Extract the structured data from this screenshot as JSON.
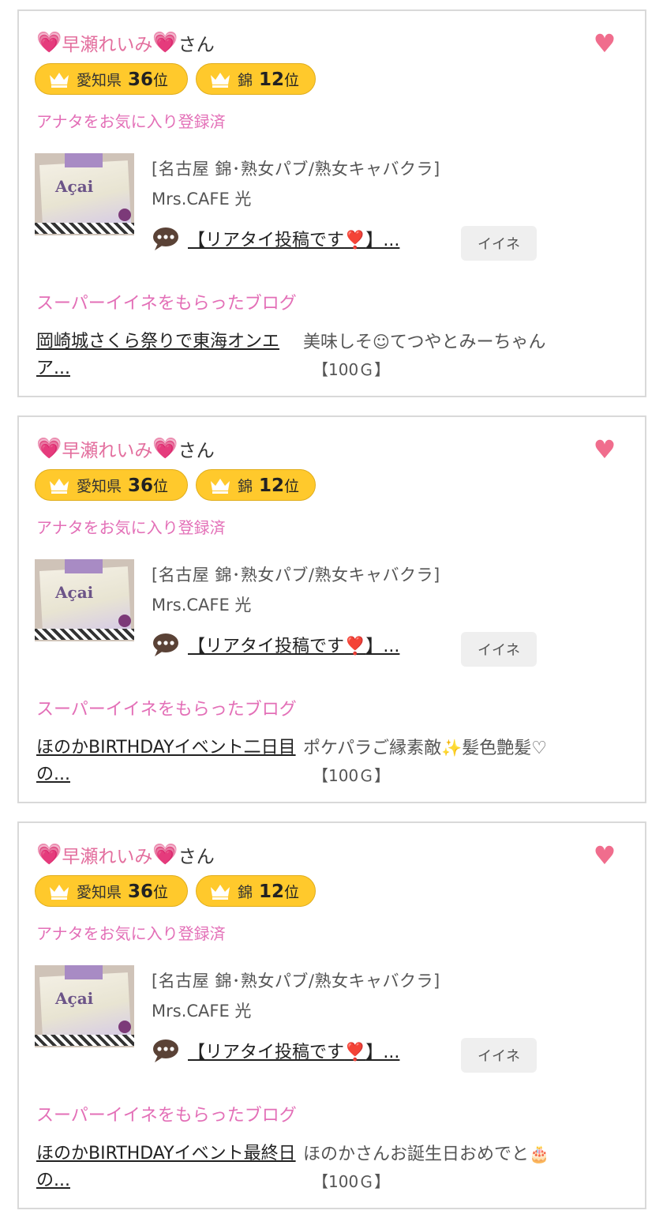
{
  "cards": [
    {
      "heart_left": "💗",
      "name": "早瀬れいみ",
      "heart_right": "💗",
      "honorific": "さん",
      "fav_heart": "♥",
      "badges": [
        {
          "area": "愛知県",
          "rank": "36",
          "suffix": "位"
        },
        {
          "area": "錦",
          "rank": "12",
          "suffix": "位"
        }
      ],
      "fav_status": "アナタをお気に入り登録済",
      "thumb_text": "Açai",
      "shop_category": "[名古屋 錦･熟女パブ/熟女キャバクラ]",
      "shop_name": "Mrs.CAFE 光",
      "post_title_pre": "【リアタイ投稿です",
      "post_title_mark": "❣️",
      "post_title_post": "】...",
      "like_label": "イイネ",
      "super_title": "スーパーイイネをもらったブログ",
      "blog_title": "岡崎城さくら祭りで東海オンエア...",
      "blog_desc_pre": "美味しそ",
      "blog_desc_emoji": "☺",
      "blog_desc_post": "てつやとみーちゃん",
      "blog_gold": "【100Ｇ】"
    },
    {
      "heart_left": "💗",
      "name": "早瀬れいみ",
      "heart_right": "💗",
      "honorific": "さん",
      "fav_heart": "♥",
      "badges": [
        {
          "area": "愛知県",
          "rank": "36",
          "suffix": "位"
        },
        {
          "area": "錦",
          "rank": "12",
          "suffix": "位"
        }
      ],
      "fav_status": "アナタをお気に入り登録済",
      "thumb_text": "Açai",
      "shop_category": "[名古屋 錦･熟女パブ/熟女キャバクラ]",
      "shop_name": "Mrs.CAFE 光",
      "post_title_pre": "【リアタイ投稿です",
      "post_title_mark": "❣️",
      "post_title_post": "】...",
      "like_label": "イイネ",
      "super_title": "スーパーイイネをもらったブログ",
      "blog_title": "ほのかBIRTHDAYイベント二日目の...",
      "blog_desc_pre": "ポケパラご縁素敵",
      "blog_desc_emoji": "✨",
      "blog_desc_post": "髪色艶髪♡",
      "blog_gold": "【100Ｇ】"
    },
    {
      "heart_left": "💗",
      "name": "早瀬れいみ",
      "heart_right": "💗",
      "honorific": "さん",
      "fav_heart": "♥",
      "badges": [
        {
          "area": "愛知県",
          "rank": "36",
          "suffix": "位"
        },
        {
          "area": "錦",
          "rank": "12",
          "suffix": "位"
        }
      ],
      "fav_status": "アナタをお気に入り登録済",
      "thumb_text": "Açai",
      "shop_category": "[名古屋 錦･熟女パブ/熟女キャバクラ]",
      "shop_name": "Mrs.CAFE 光",
      "post_title_pre": "【リアタイ投稿です",
      "post_title_mark": "❣️",
      "post_title_post": "】...",
      "like_label": "イイネ",
      "super_title": "スーパーイイネをもらったブログ",
      "blog_title": "ほのかBIRTHDAYイベント最終日の...",
      "blog_desc_pre": "ほのかさんお誕生日おめでと",
      "blog_desc_emoji": "🎂",
      "blog_desc_post": "",
      "blog_gold": "【100Ｇ】"
    }
  ],
  "colors": {
    "name_pink": "#e36f9e",
    "section_pink": "#e36fb7",
    "badge_yellow": "#ffc92c",
    "fav_heart": "#f06d8d",
    "border": "#d9d9d9",
    "like_bg": "#efefef"
  },
  "icons": {
    "badge": "crown-icon",
    "post": "speech-bubble-icon",
    "favorite": "heart-icon"
  }
}
